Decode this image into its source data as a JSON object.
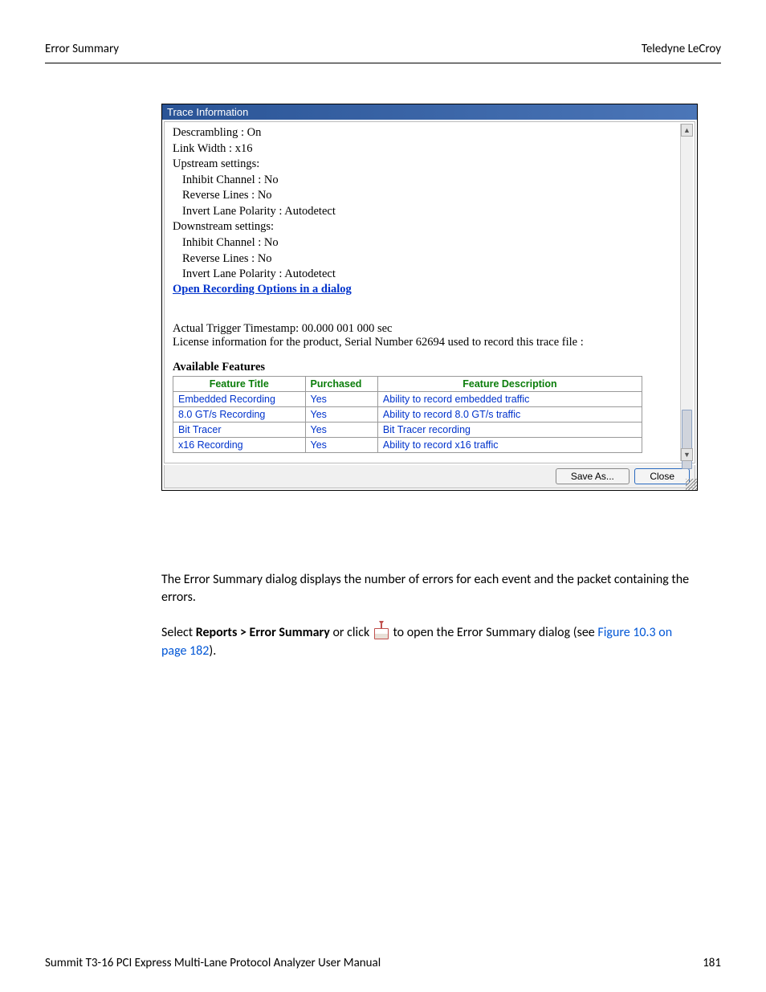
{
  "header": {
    "left": "Error Summary",
    "right": "Teledyne LeCroy"
  },
  "dialog": {
    "title": "Trace Information",
    "info": {
      "descrambling": "Descrambling : On",
      "link_width": "Link Width : x16",
      "upstream_label": "Upstream settings:",
      "up_inhibit": "Inhibit Channel : No",
      "up_reverse": "Reverse Lines : No",
      "up_polarity": "Invert Lane Polarity : Autodetect",
      "downstream_label": "Downstream settings:",
      "dn_inhibit": "Inhibit Channel : No",
      "dn_reverse": "Reverse Lines : No",
      "dn_polarity": "Invert Lane Polarity : Autodetect",
      "open_link": "Open Recording Options in a dialog",
      "trigger_ts": "Actual Trigger Timestamp: 00.000 001 000 sec",
      "license_info": "License information for the product, Serial Number 62694 used to record this trace file :"
    },
    "features_heading": "Available Features",
    "features": {
      "headers": {
        "c1": "Feature Title",
        "c2": "Purchased",
        "c3": "Feature Description"
      },
      "rows": [
        {
          "title": "Embedded Recording",
          "purchased": "Yes",
          "desc": "Ability to record embedded traffic"
        },
        {
          "title": "8.0 GT/s Recording",
          "purchased": "Yes",
          "desc": "Ability to record 8.0 GT/s traffic"
        },
        {
          "title": "Bit Tracer",
          "purchased": "Yes",
          "desc": "Bit Tracer recording"
        },
        {
          "title": "x16 Recording",
          "purchased": "Yes",
          "desc": "Ability to record x16 traffic"
        }
      ]
    },
    "buttons": {
      "save": "Save As...",
      "close": "Close"
    }
  },
  "body": {
    "para1": "The Error Summary dialog displays the number of errors for each event and the packet containing the errors.",
    "para2_pre": "Select ",
    "para2_bold": "Reports > Error Summary",
    "para2_mid": " or click ",
    "para2_post": " to open the Error Summary dialog (see ",
    "para2_link": "Figure 10.3 on page 182",
    "para2_end": ")."
  },
  "footer": {
    "left": "Summit T3-16 PCI Express Multi-Lane Protocol Analyzer User Manual",
    "right": "181"
  }
}
